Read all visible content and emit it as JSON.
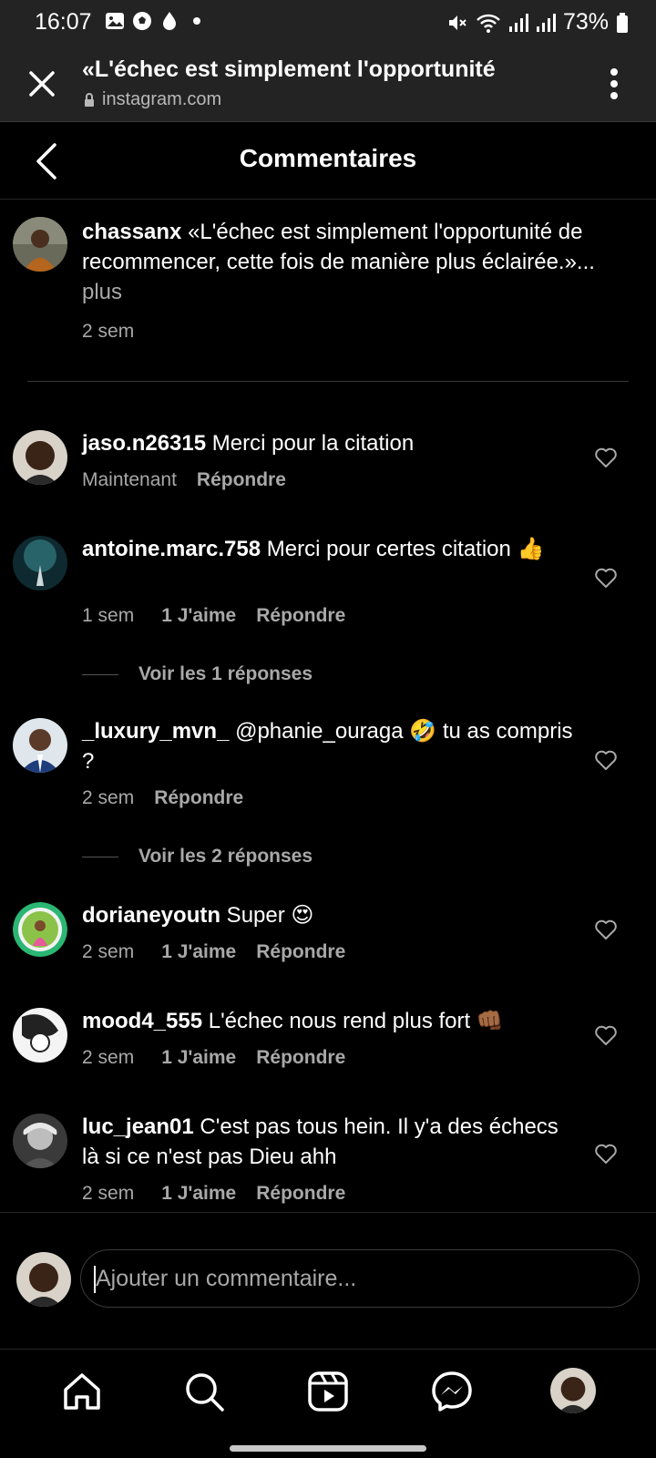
{
  "status_bar": {
    "time": "16:07",
    "battery": "73%"
  },
  "browser": {
    "title": "«L'échec est simplement l'opportunité",
    "url": "instagram.com"
  },
  "header": {
    "title": "Commentaires"
  },
  "caption": {
    "username": "chassanx",
    "text": " «L'échec est simplement l'opportunité de recommencer, cette fois de manière plus éclairée.»...",
    "more": "plus",
    "time": "2 sem"
  },
  "comments": [
    {
      "username": "jaso.n26315",
      "text": " Merci pour la citation",
      "time": "Maintenant",
      "likes": "",
      "reply": "Répondre"
    },
    {
      "username": "antoine.marc.758",
      "text": " Merci pour certes citation 👍",
      "time": "1 sem",
      "likes": "1 J'aime",
      "reply": "Répondre",
      "replies": "Voir les 1 réponses"
    },
    {
      "username": "_luxury_mvn_",
      "text": " @phanie_ouraga 🤣 tu as compris ?",
      "time": "2 sem",
      "likes": "",
      "reply": "Répondre",
      "replies": "Voir les 2 réponses"
    },
    {
      "username": "dorianeyoutn",
      "text": " Super 😍",
      "time": "2 sem",
      "likes": "1 J'aime",
      "reply": "Répondre"
    },
    {
      "username": "mood4_555",
      "text": " L'échec nous rend plus fort 👊🏾",
      "time": "2 sem",
      "likes": "1 J'aime",
      "reply": "Répondre"
    },
    {
      "username": "luc_jean01",
      "text": " C'est pas tous hein. Il y'a des échecs là si ce n'est pas Dieu ahh",
      "time": "2 sem",
      "likes": "1 J'aime",
      "reply": "Répondre"
    }
  ],
  "composer": {
    "placeholder": "Ajouter un commentaire..."
  },
  "nav": [
    "home-icon",
    "search-icon",
    "reels-icon",
    "messenger-icon",
    "profile-avatar"
  ]
}
